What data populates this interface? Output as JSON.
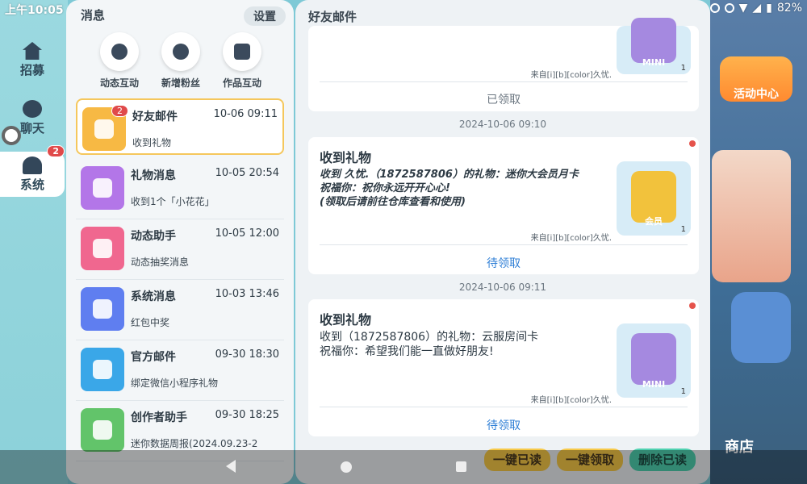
{
  "status": {
    "time": "上午10:05",
    "battery": "82%"
  },
  "game": {
    "left_tabs": [
      {
        "label": "招募"
      },
      {
        "label": "聊天"
      },
      {
        "label": "系统",
        "badge": "2"
      }
    ],
    "activity_label": "活动中心",
    "shop_label": "商店"
  },
  "messages": {
    "header": "消息",
    "settings": "设置",
    "quick_actions": [
      {
        "label": "动态互动",
        "icon": "dynamic-icon"
      },
      {
        "label": "新增粉丝",
        "icon": "new-fan-icon"
      },
      {
        "label": "作品互动",
        "icon": "works-icon"
      }
    ],
    "items": [
      {
        "title": "好友邮件",
        "time": "10-06 09:11",
        "sub": "收到礼物",
        "badge": "2",
        "color": "#f7b944"
      },
      {
        "title": "礼物消息",
        "time": "10-05 20:54",
        "sub": "收到1个「小花花」",
        "color": "#b376e8"
      },
      {
        "title": "动态助手",
        "time": "10-05 12:00",
        "sub": "动态抽奖消息",
        "color": "#f0678f"
      },
      {
        "title": "系统消息",
        "time": "10-03 13:46",
        "sub": "红包中奖",
        "color": "#5f7ef0"
      },
      {
        "title": "官方邮件",
        "time": "09-30 18:30",
        "sub": "绑定微信小程序礼物",
        "color": "#3aa7e8"
      },
      {
        "title": "创作者助手",
        "time": "09-30 18:25",
        "sub": "迷你数据周报(2024.09.23-2",
        "color": "#62c46a"
      }
    ]
  },
  "detail": {
    "title": "好友邮件",
    "top_card": {
      "from": "来自[i][b][color]久忧.",
      "status": "已领取"
    },
    "cards": [
      {
        "date": "2024-10-06 09:10",
        "title": "收到礼物",
        "line1": "收到 久忧.（1872587806）的礼物：迷你大会员月卡",
        "line2": "祝福你：祝你永远开开心心!",
        "line3": "(领取后请前往仓库查看和使用)",
        "from": "来自[i][b][color]久忧.",
        "status": "待领取",
        "gift_label": "会员",
        "gift_count": "1"
      },
      {
        "date": "2024-10-06 09:11",
        "title": "收到礼物",
        "line1": "收到（1872587806）的礼物：云服房间卡",
        "line2": "祝福你：希望我们能一直做好朋友!",
        "from": "来自[i][b][color]久忧.",
        "status": "待领取",
        "gift_label": "MINI",
        "gift_count": "1"
      }
    ],
    "top_gift_label": "MINI",
    "top_gift_count": "1"
  },
  "bottom": {
    "read_all": "一键已读",
    "claim_all": "一键领取",
    "delete_read": "删除已读"
  }
}
